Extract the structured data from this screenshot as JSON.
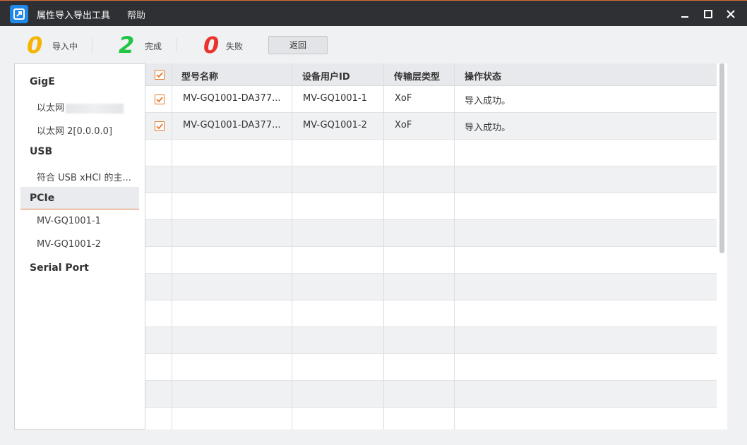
{
  "window": {
    "title": "属性导入导出工具",
    "menu_help": "帮助"
  },
  "status": {
    "importing_count": "0",
    "importing_label": "导入中",
    "done_count": "2",
    "done_label": "完成",
    "failed_count": "0",
    "failed_label": "失败",
    "back_label": "返回"
  },
  "colors": {
    "importing": "#f5b400",
    "done": "#21c545",
    "failed": "#e8332f",
    "accent": "#e57a2e"
  },
  "sidebar": {
    "gige": "GigE",
    "gige_item1": "以太网",
    "gige_item2": "以太网 2[0.0.0.0]",
    "usb": "USB",
    "usb_item1": "符合 USB xHCI 的主...",
    "pcie": "PCIe",
    "pcie_item1": "MV-GQ1001-1",
    "pcie_item2": "MV-GQ1001-2",
    "serial": "Serial Port"
  },
  "table": {
    "columns": [
      "型号名称",
      "设备用户ID",
      "传输层类型",
      "操作状态"
    ],
    "rows": [
      {
        "model": "MV-GQ1001-DA377...",
        "user_id": "MV-GQ1001-1",
        "transport": "XoF",
        "status": "导入成功。"
      },
      {
        "model": "MV-GQ1001-DA377...",
        "user_id": "MV-GQ1001-2",
        "transport": "XoF",
        "status": "导入成功。"
      }
    ]
  },
  "icons": {
    "app": "export-arrow-icon",
    "minimize": "minimize-icon",
    "maximize": "maximize-icon",
    "close": "close-icon",
    "check": "check-icon"
  }
}
